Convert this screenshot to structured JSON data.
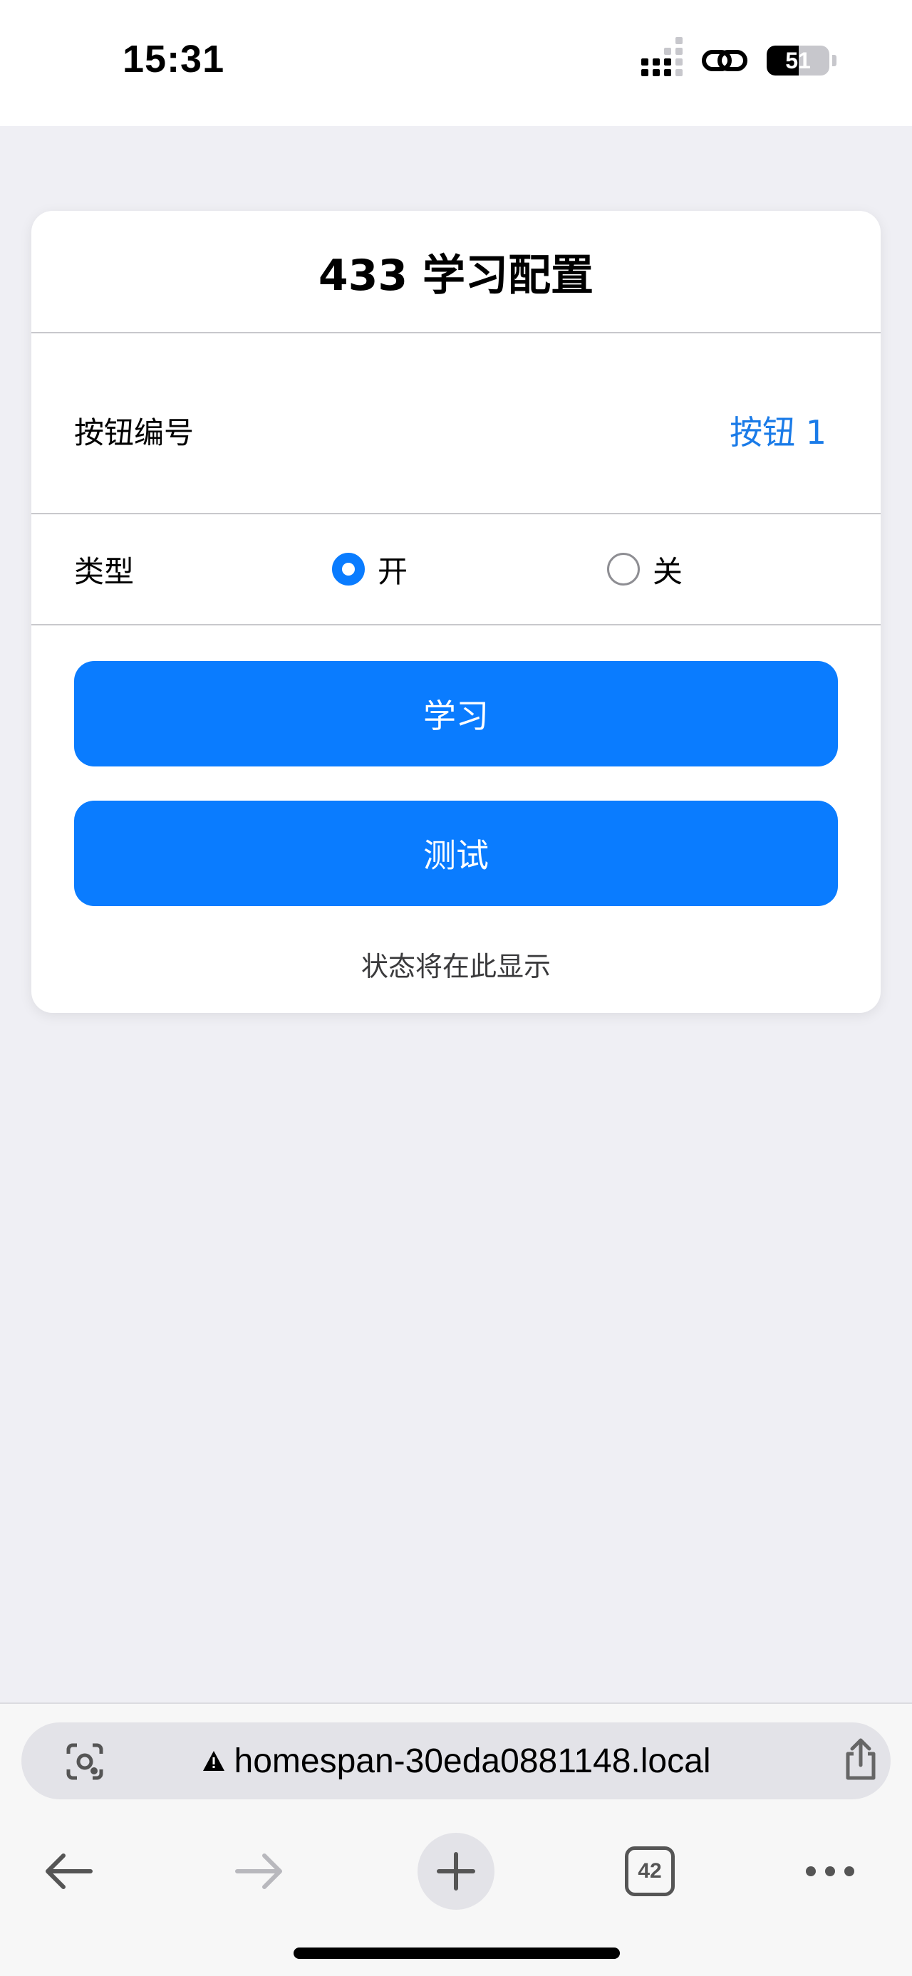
{
  "status_bar": {
    "time": "15:31",
    "battery_level": "51",
    "battery_fraction": 0.51,
    "icons": [
      "signal-icon",
      "link-icon",
      "battery-icon"
    ]
  },
  "card": {
    "title": "433 学习配置",
    "button_number": {
      "label": "按钮编号",
      "value": "按钮 1"
    },
    "type": {
      "label": "类型",
      "options": [
        {
          "label": "开",
          "selected": true
        },
        {
          "label": "关",
          "selected": false
        }
      ]
    },
    "learn_button": "学习",
    "test_button": "测试",
    "status_text": "状态将在此显示"
  },
  "browser": {
    "url": "homespan-30eda0881148.local",
    "tab_count": "42",
    "icons": [
      "lens-icon",
      "warning-icon",
      "share-icon",
      "back-icon",
      "forward-icon",
      "plus-icon",
      "tabs-icon",
      "more-icon"
    ]
  },
  "colors": {
    "accent": "#0a7cff",
    "value_text": "#1a7be8",
    "background": "#efeff4"
  }
}
